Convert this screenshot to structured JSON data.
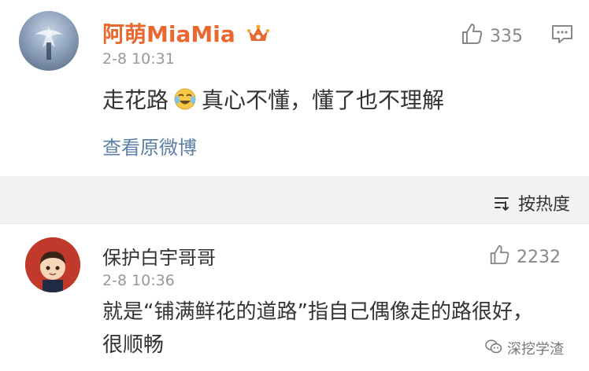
{
  "post": {
    "user_name": "阿萌MiaMia",
    "time": "2-8 10:31",
    "content_before_emoji": "走花路",
    "content_after_emoji": "真心不懂，懂了也不理解",
    "like_count": "335",
    "view_original_link": "查看原微博"
  },
  "sort": {
    "label": "按热度"
  },
  "comment": {
    "user_name": "保护白宇哥哥",
    "time": "2-8 10:36",
    "content": "就是“铺满鲜花的道路”指自己偶像走的路很好，很顺畅",
    "like_count": "2232"
  },
  "watermark": {
    "text": "深挖学渣"
  },
  "colors": {
    "username_highlight": "#e8682f",
    "link_blue": "#5b7fa6",
    "meta_gray": "#999999",
    "divider_gray": "#f2f2f2"
  },
  "icons": [
    "crown-icon",
    "laughing-crying-emoji",
    "thumbs-up-icon",
    "comment-icon",
    "sort-icon",
    "wechat-icon"
  ]
}
